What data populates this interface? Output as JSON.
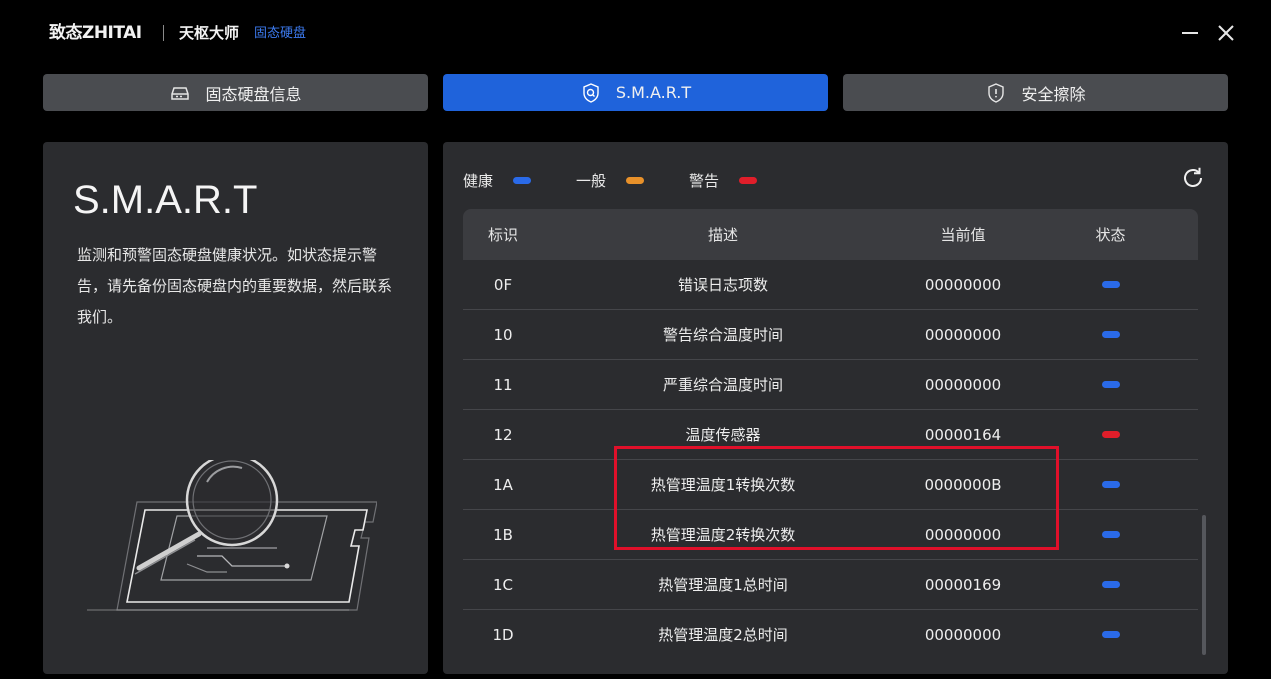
{
  "titlebar": {
    "brand": "致态ZHITAI",
    "app_name": "天枢大师",
    "app_sub": "固态硬盘",
    "minimize_icon": "minimize-icon",
    "close_icon": "close-icon"
  },
  "tabs": [
    {
      "label": "固态硬盘信息",
      "icon": "drive-icon",
      "active": false
    },
    {
      "label": "S.M.A.R.T",
      "icon": "shield-search-icon",
      "active": true
    },
    {
      "label": "安全擦除",
      "icon": "shield-alert-icon",
      "active": false
    }
  ],
  "left_panel": {
    "title": "S.M.A.R.T",
    "description": "监测和预警固态硬盘健康状况。如状态提示警告，请先备份固态硬盘内的重要数据，然后联系我们。"
  },
  "legend": [
    {
      "label": "健康",
      "color": "#2a6ae8"
    },
    {
      "label": "一般",
      "color": "#e8912a"
    },
    {
      "label": "警告",
      "color": "#e01e2a"
    }
  ],
  "table": {
    "headers": {
      "id": "标识",
      "desc": "描述",
      "value": "当前值",
      "status": "状态"
    },
    "rows": [
      {
        "id": "0F",
        "desc": "错误日志项数",
        "value": "00000000",
        "status": "健康"
      },
      {
        "id": "10",
        "desc": "警告综合温度时间",
        "value": "00000000",
        "status": "健康"
      },
      {
        "id": "11",
        "desc": "严重综合温度时间",
        "value": "00000000",
        "status": "健康"
      },
      {
        "id": "12",
        "desc": "温度传感器",
        "value": "00000164",
        "status": "警告"
      },
      {
        "id": "1A",
        "desc": "热管理温度1转换次数",
        "value": "0000000B",
        "status": "健康"
      },
      {
        "id": "1B",
        "desc": "热管理温度2转换次数",
        "value": "00000000",
        "status": "健康"
      },
      {
        "id": "1C",
        "desc": "热管理温度1总时间",
        "value": "00000169",
        "status": "健康"
      },
      {
        "id": "1D",
        "desc": "热管理温度2总时间",
        "value": "00000000",
        "status": "健康"
      }
    ]
  },
  "colors": {
    "accent": "#1f63db",
    "healthy": "#2a6ae8",
    "normal": "#e8912a",
    "warning": "#e01e2a",
    "highlight": "#e0102a"
  }
}
